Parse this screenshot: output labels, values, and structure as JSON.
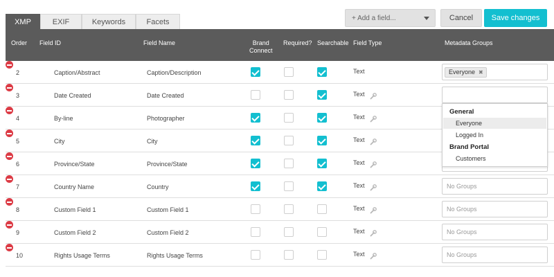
{
  "tabs": [
    {
      "label": "XMP",
      "active": true
    },
    {
      "label": "EXIF",
      "active": false
    },
    {
      "label": "Keywords",
      "active": false
    },
    {
      "label": "Facets",
      "active": false
    }
  ],
  "toolbar": {
    "add_field_placeholder": "+ Add a field...",
    "cancel_label": "Cancel",
    "save_label": "Save changes"
  },
  "colors": {
    "accent": "#13bfd0",
    "header": "#5b5b5b",
    "remove": "#dc3b45"
  },
  "columns": {
    "order": "Order",
    "field_id": "Field ID",
    "field_name": "Field Name",
    "brand_connect": "Brand\nConnect",
    "required": "Required?",
    "searchable": "Searchable",
    "field_type": "Field Type",
    "metadata_groups": "Metadata Groups"
  },
  "rows": [
    {
      "order": "2",
      "field_id": "Caption/Abstract",
      "field_name": "Caption/Description",
      "brand_connect": true,
      "required": false,
      "searchable": true,
      "field_type": "Text",
      "settings_icon": false,
      "groups_chip": "Everyone",
      "groups_text": ""
    },
    {
      "order": "3",
      "field_id": "Date Created",
      "field_name": "Date Created",
      "brand_connect": false,
      "required": false,
      "searchable": true,
      "field_type": "Text",
      "settings_icon": true,
      "groups_chip": "",
      "groups_text": ""
    },
    {
      "order": "4",
      "field_id": "By-line",
      "field_name": "Photographer",
      "brand_connect": true,
      "required": false,
      "searchable": true,
      "field_type": "Text",
      "settings_icon": true,
      "groups_chip": "",
      "groups_text": ""
    },
    {
      "order": "5",
      "field_id": "City",
      "field_name": "City",
      "brand_connect": true,
      "required": false,
      "searchable": true,
      "field_type": "Text",
      "settings_icon": true,
      "groups_chip": "",
      "groups_text": ""
    },
    {
      "order": "6",
      "field_id": "Province/State",
      "field_name": "Province/State",
      "brand_connect": true,
      "required": false,
      "searchable": true,
      "field_type": "Text",
      "settings_icon": true,
      "groups_chip": "",
      "groups_text": ""
    },
    {
      "order": "7",
      "field_id": "Country Name",
      "field_name": "Country",
      "brand_connect": true,
      "required": false,
      "searchable": true,
      "field_type": "Text",
      "settings_icon": true,
      "groups_chip": "",
      "groups_text": "No Groups"
    },
    {
      "order": "8",
      "field_id": "Custom Field 1",
      "field_name": "Custom Field 1",
      "brand_connect": false,
      "required": false,
      "searchable": false,
      "field_type": "Text",
      "settings_icon": true,
      "groups_chip": "",
      "groups_text": "No Groups"
    },
    {
      "order": "9",
      "field_id": "Custom Field 2",
      "field_name": "Custom Field 2",
      "brand_connect": false,
      "required": false,
      "searchable": false,
      "field_type": "Text",
      "settings_icon": true,
      "groups_chip": "",
      "groups_text": "No Groups"
    },
    {
      "order": "10",
      "field_id": "Rights Usage Terms",
      "field_name": "Rights Usage Terms",
      "brand_connect": false,
      "required": false,
      "searchable": false,
      "field_type": "Text",
      "settings_icon": true,
      "groups_chip": "",
      "groups_text": "No Groups"
    }
  ],
  "groups_dropdown": {
    "sections": [
      {
        "title": "General",
        "options": [
          {
            "label": "Everyone",
            "highlighted": true
          },
          {
            "label": "Logged In",
            "highlighted": false
          }
        ]
      },
      {
        "title": "Brand Portal",
        "options": [
          {
            "label": "Customers",
            "highlighted": false
          }
        ]
      }
    ]
  }
}
